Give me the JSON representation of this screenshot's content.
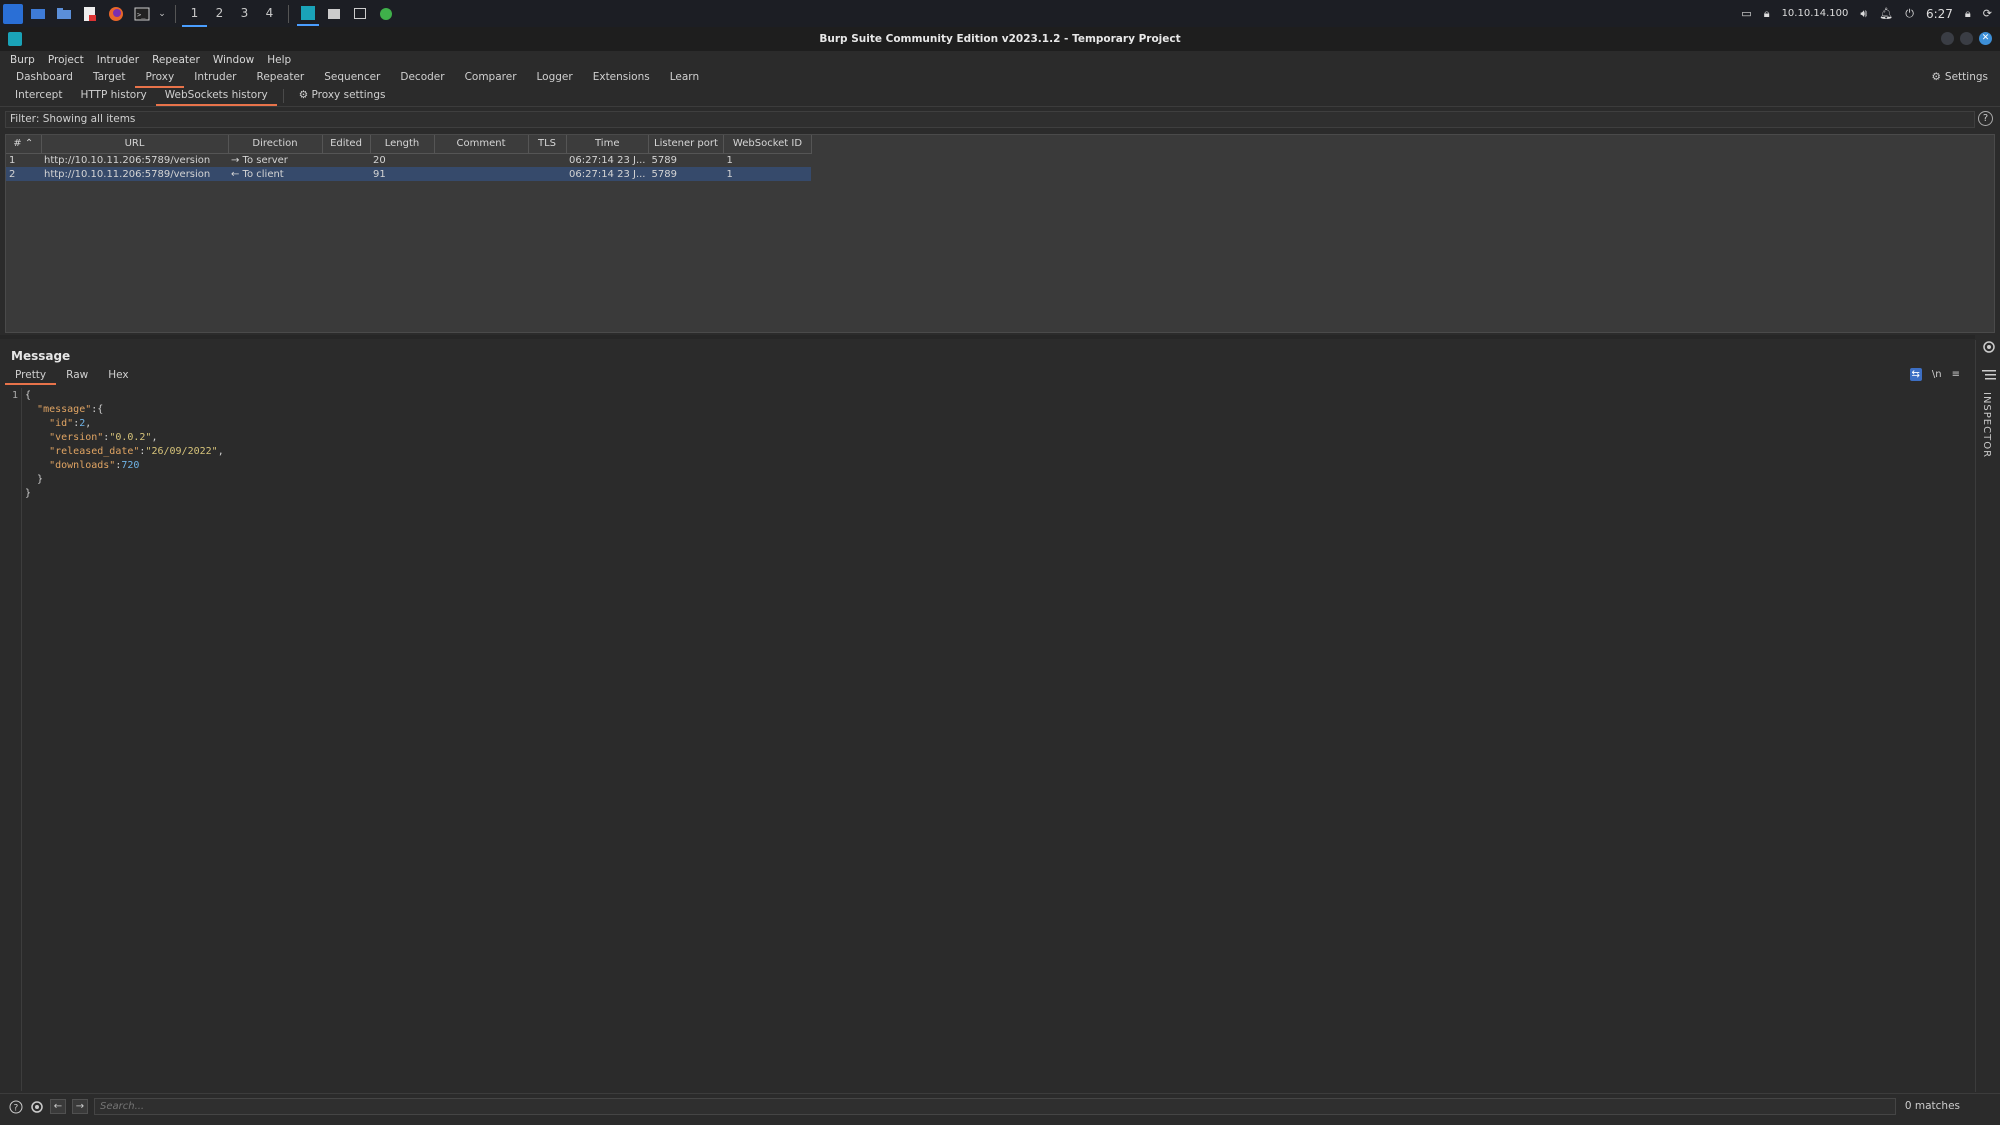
{
  "taskbar": {
    "workspaces": [
      "1",
      "2",
      "3",
      "4"
    ],
    "ip": "10.10.14.100",
    "time": "6:27"
  },
  "window": {
    "title": "Burp Suite Community Edition v2023.1.2 - Temporary Project"
  },
  "menubar": [
    "Burp",
    "Project",
    "Intruder",
    "Repeater",
    "Window",
    "Help"
  ],
  "main_tabs": [
    "Dashboard",
    "Target",
    "Proxy",
    "Intruder",
    "Repeater",
    "Sequencer",
    "Decoder",
    "Comparer",
    "Logger",
    "Extensions",
    "Learn"
  ],
  "settings_label": "Settings",
  "sub_tabs": [
    "Intercept",
    "HTTP history",
    "WebSockets history"
  ],
  "proxy_settings_label": "Proxy settings",
  "filter_text": "Filter: Showing all items",
  "table": {
    "columns": [
      "#",
      "URL",
      "Direction",
      "Edited",
      "Length",
      "Comment",
      "TLS",
      "Time",
      "Listener port",
      "WebSocket ID"
    ],
    "rows": [
      {
        "num": "1",
        "url": "http://10.10.11.206:5789/version",
        "direction": "→ To server",
        "edited": "",
        "length": "20",
        "comment": "",
        "tls": "",
        "time": "06:27:14 23 J...",
        "port": "5789",
        "wsid": "1"
      },
      {
        "num": "2",
        "url": "http://10.10.11.206:5789/version",
        "direction": "← To client",
        "edited": "",
        "length": "91",
        "comment": "",
        "tls": "",
        "time": "06:27:14 23 J...",
        "port": "5789",
        "wsid": "1"
      }
    ]
  },
  "message": {
    "title": "Message",
    "tabs": [
      "Pretty",
      "Raw",
      "Hex"
    ],
    "tools": [
      "wrap",
      "\\n",
      "≡"
    ],
    "line_number": "1",
    "json": {
      "id_key": "\"id\"",
      "id_val": "2",
      "version_key": "\"version\"",
      "version_val": "\"0.0.2\"",
      "released_key": "\"released_date\"",
      "released_val": "\"26/09/2022\"",
      "downloads_key": "\"downloads\"",
      "downloads_val": "720",
      "message_key": "\"message\""
    }
  },
  "inspector_label": "INSPECTOR",
  "search": {
    "placeholder": "Search...",
    "matches": "0 matches"
  }
}
